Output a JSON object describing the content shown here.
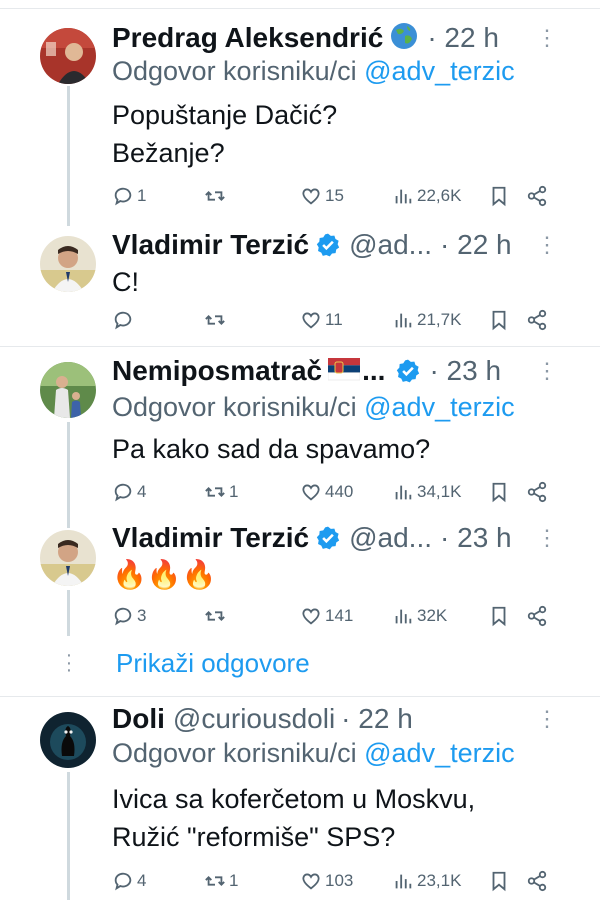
{
  "tweets": [
    {
      "name": "Predrag Aleksendrić",
      "handle": "",
      "time": "· 22 h",
      "badge": "globe-emoji",
      "reply_prefix": "Odgovor korisniku/ci",
      "reply_mention": "@adv_terzic",
      "text": "Popuštanje Dačić?\nBežanje?",
      "stats": {
        "replies": "1",
        "retweets": "",
        "likes": "15",
        "views": "22,6K"
      }
    },
    {
      "name": "Vladimir Terzić",
      "handle": "@ad...",
      "time": "· 22 h",
      "badge": "verified",
      "text": "C!",
      "stats": {
        "replies": "",
        "retweets": "",
        "likes": "11",
        "views": "21,7K"
      }
    },
    {
      "name": "Nemiposmatrač",
      "name_suffix": "...",
      "handle": "",
      "time": "· 23 h",
      "badge": "serbia-flag-emoji",
      "reply_prefix": "Odgovor korisniku/ci",
      "reply_mention": "@adv_terzic",
      "text": "Pa kako sad da spavamo?",
      "stats": {
        "replies": "4",
        "retweets": "1",
        "likes": "440",
        "views": "34,1K"
      }
    },
    {
      "name": "Vladimir Terzić",
      "handle": "@ad...",
      "time": "· 23 h",
      "badge": "verified",
      "text": "🔥🔥🔥",
      "stats": {
        "replies": "3",
        "retweets": "",
        "likes": "141",
        "views": "32K"
      }
    },
    {
      "name": "Doli",
      "handle": "@curiousdoli",
      "time": "· 22 h",
      "reply_prefix": "Odgovor korisniku/ci",
      "reply_mention": "@adv_terzic",
      "text": "Ivica sa koferčetom u Moskvu,\nRužić \"reformiše\" SPS?",
      "stats": {
        "replies": "4",
        "retweets": "1",
        "likes": "103",
        "views": "23,1K"
      }
    }
  ],
  "show_replies_label": "Prikaži odgovore",
  "more_glyph": "⋮",
  "colors": {
    "link": "#1d9bf0",
    "secondary": "#536471",
    "verified": "#1d9bf0",
    "line": "#cfd9de"
  }
}
